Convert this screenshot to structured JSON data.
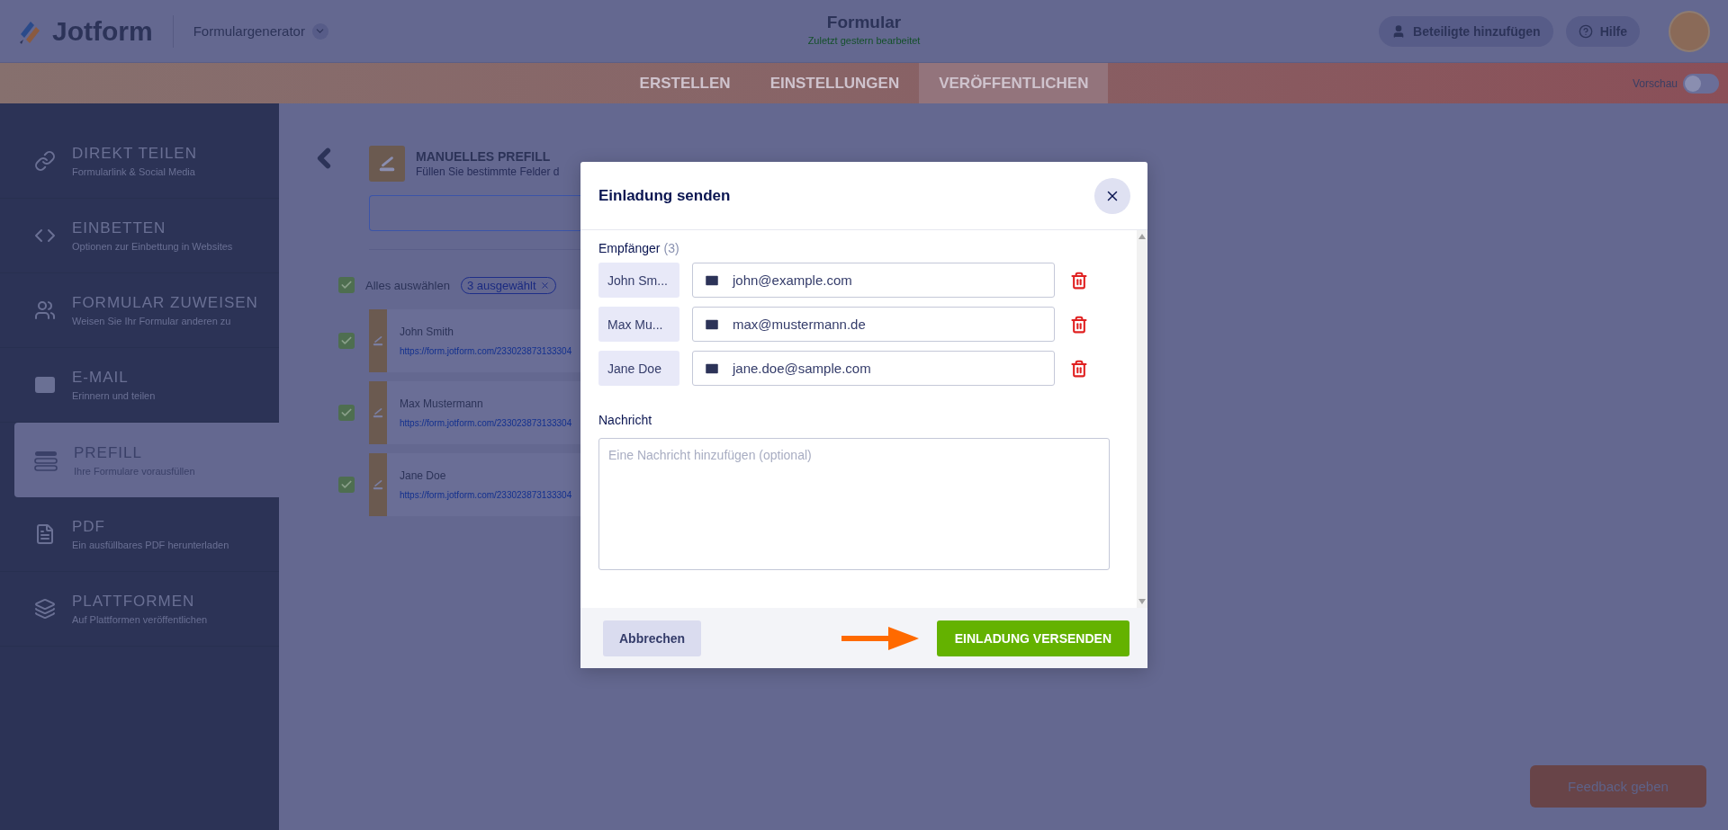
{
  "header": {
    "logo": "Jotform",
    "builder": "Formulargenerator",
    "title": "Formular",
    "subtitle": "Zuletzt gestern bearbeitet",
    "actions": [
      {
        "label": "Beteiligte hinzufügen"
      },
      {
        "label": "Hilfe"
      }
    ]
  },
  "tabs": [
    {
      "label": "ERSTELLEN",
      "selected": false
    },
    {
      "label": "EINSTELLUNGEN",
      "selected": false
    },
    {
      "label": "VERÖFFENTLICHEN",
      "selected": true
    }
  ],
  "preview": {
    "label": "Vorschau",
    "on": false
  },
  "sidebar": {
    "items": [
      {
        "title": "DIREKT TEILEN",
        "subtitle": "Formularlink & Social Media",
        "selected": false
      },
      {
        "title": "EINBETTEN",
        "subtitle": "Optionen zur Einbettung in Websites",
        "selected": false
      },
      {
        "title": "FORMULAR ZUWEISEN",
        "subtitle": "Weisen Sie Ihr Formular anderen zu",
        "selected": false
      },
      {
        "title": "E-MAIL",
        "subtitle": "Erinnern und teilen",
        "selected": false
      },
      {
        "title": "PREFILL",
        "subtitle": "Ihre Formulare vorausfüllen",
        "selected": true
      },
      {
        "title": "PDF",
        "subtitle": "Ein ausfüllbares PDF herunterladen",
        "selected": false
      },
      {
        "title": "PLATTFORMEN",
        "subtitle": "Auf Plattformen veröffentlichen",
        "selected": false
      }
    ]
  },
  "prefill": {
    "title": "MANUELLES PREFILL",
    "subtitle": "Füllen Sie bestimmte Felder d",
    "select_all": {
      "label": "Alles auswählen",
      "checked": true
    },
    "selected_badge": "3 ausgewählt",
    "entries": [
      {
        "name": "John Smith",
        "url": "https://form.jotform.com/233023873133304",
        "checked": true
      },
      {
        "name": "Max Mustermann",
        "url": "https://form.jotform.com/233023873133304",
        "checked": true
      },
      {
        "name": "Jane Doe",
        "url": "https://form.jotform.com/233023873133304",
        "checked": true
      }
    ]
  },
  "modal": {
    "title": "Einladung senden",
    "recipients_label": "Empfänger",
    "recipients_count": "(3)",
    "recipients": [
      {
        "name": "John Sm...",
        "email": "john@example.com"
      },
      {
        "name": "Max Mu...",
        "email": "max@mustermann.de"
      },
      {
        "name": "Jane Doe",
        "email": "jane.doe@sample.com"
      }
    ],
    "message_label": "Nachricht",
    "message_placeholder": "Eine Nachricht hinzufügen (optional)",
    "cancel": "Abbrechen",
    "submit": "EINLADUNG VERSENDEN"
  },
  "feedback": "Feedback geben"
}
